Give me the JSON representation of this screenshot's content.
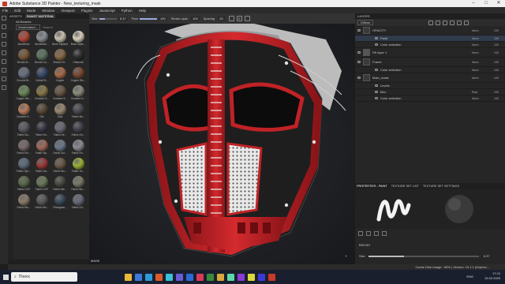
{
  "window": {
    "title": "Adobe Substance 3D Painter - New_texturing_mask",
    "controls": [
      "–",
      "□",
      "✕"
    ]
  },
  "menu": [
    "File",
    "Edit",
    "Mode",
    "Window",
    "Viewport",
    "Plugins",
    "Javascript",
    "Python",
    "Help"
  ],
  "toolbar": {
    "size_label": "Size",
    "size_value": "6.37",
    "size_fraction": 0.32,
    "flow_label": "Flow",
    "flow_value": "100",
    "flow_fraction": 1.0,
    "stroke_opacity_label": "Stroke opac",
    "stroke_opacity_value": "100",
    "spacing_label": "Spacing",
    "spacing_value": "20",
    "symmetry_label": "X"
  },
  "assets": {
    "tabs": [
      "ASSETS",
      "SMART MATERIAL"
    ],
    "library_label": "All libraries",
    "filter_chip": "Smartmateri...",
    "search_placeholder": "Search",
    "materials": [
      {
        "name": "Aluminium",
        "color": "#b34a3c"
      },
      {
        "name": "Aluminium...",
        "color": "#8a8f95"
      },
      {
        "name": "Bone Stylized",
        "color": "#c9c1b0"
      },
      {
        "name": "Bone Styliz...",
        "color": "#d8cfba"
      },
      {
        "name": "Bronze Ar...",
        "color": "#7a5a3a"
      },
      {
        "name": "Bronze Co...",
        "color": "#5e7560"
      },
      {
        "name": "Bronze St...",
        "color": "#8a6a48"
      },
      {
        "name": "Charcoal",
        "color": "#2f2f2f"
      },
      {
        "name": "Chrome Bl...",
        "color": "#6a7080"
      },
      {
        "name": "Cobalt St...",
        "color": "#3c4a6a"
      },
      {
        "name": "Copper",
        "color": "#a86a4a"
      },
      {
        "name": "Copper Wo...",
        "color": "#7a4a32"
      },
      {
        "name": "Copper We...",
        "color": "#6e8a5a"
      },
      {
        "name": "Creature S...",
        "color": "#8a7a4a"
      },
      {
        "name": "Creature S...",
        "color": "#6a5a48"
      },
      {
        "name": "Creature S...",
        "color": "#8c8c7c"
      },
      {
        "name": "Creature S...",
        "color": "#b87a5a"
      },
      {
        "name": "Dirt",
        "color": "#5a4a38"
      },
      {
        "name": "Dust",
        "color": "#9a8a72"
      },
      {
        "name": "Fabric Ba...",
        "color": "#4a4a52"
      },
      {
        "name": "Fabric Bu...",
        "color": "#5a5a62"
      },
      {
        "name": "Fabric De...",
        "color": "#3a3a48"
      },
      {
        "name": "Fabric De...",
        "color": "#6a6a78"
      },
      {
        "name": "Fabric Ge...",
        "color": "#42424e"
      },
      {
        "name": "Fabric Kni...",
        "color": "#7a6a6a"
      },
      {
        "name": "Fabric Ny...",
        "color": "#a06a5a"
      },
      {
        "name": "Fabric Sof...",
        "color": "#6a7a8a"
      },
      {
        "name": "Fabric Ro...",
        "color": "#8a8a92"
      },
      {
        "name": "Fabric Syn...",
        "color": "#5a6a7a"
      },
      {
        "name": "Fabric Sa...",
        "color": "#9a3a3a"
      },
      {
        "name": "Fabric Wo...",
        "color": "#6a5a48"
      },
      {
        "name": "Fabric Ya...",
        "color": "#9ab03a"
      },
      {
        "name": "Fabric UCP",
        "color": "#5a6a4a"
      },
      {
        "name": "Fabric UCP",
        "color": "#6a7a5a"
      },
      {
        "name": "Fabric We...",
        "color": "#4a4a42"
      },
      {
        "name": "Fabric Wo...",
        "color": "#7a7a6a"
      },
      {
        "name": "Fabric Wo...",
        "color": "#8a7a6a"
      },
      {
        "name": "Fabric Wo...",
        "color": "#5a5a5a"
      },
      {
        "name": "Fiberglass...",
        "color": "#3a4a5a"
      },
      {
        "name": "Fabric Dri...",
        "color": "#6a6a7a"
      }
    ]
  },
  "viewport": {
    "label": "MASK",
    "axis": "Y"
  },
  "layers": {
    "header": "LAYERS",
    "blend_mode": "Diffuse",
    "rows": [
      {
        "name": "OPACITY",
        "blend": "Norm",
        "opacity": "100",
        "kind": "folder",
        "thumb": "#3a3a3a"
      },
      {
        "name": "Paint",
        "blend": "Norm",
        "opacity": "100",
        "kind": "sub",
        "selected": true,
        "thumb": "#2a2a2a"
      },
      {
        "name": "Color selection",
        "blend": "Norm",
        "opacity": "100",
        "kind": "sub",
        "thumb": "#2a2a2a"
      },
      {
        "name": "Fill layer 1",
        "blend": "Norm",
        "opacity": "100",
        "kind": "layer",
        "thumb": "#555"
      },
      {
        "name": "Frame",
        "blend": "Norm",
        "opacity": "100",
        "kind": "folder",
        "thumb": "#3a3a3a"
      },
      {
        "name": "Color selection",
        "blend": "Norm",
        "opacity": "100",
        "kind": "sub",
        "thumb": "#2a2a2a"
      },
      {
        "name": "Main_mask",
        "blend": "Norm",
        "opacity": "100",
        "kind": "folder",
        "thumb": "#3a3a3a"
      },
      {
        "name": "Levels",
        "blend": "",
        "opacity": "",
        "kind": "sub",
        "thumb": "#2a2a2a"
      },
      {
        "name": "Blur",
        "blend": "Repl",
        "opacity": "100",
        "kind": "sub",
        "thumb": "#2a2a2a"
      },
      {
        "name": "Color selection",
        "blend": "Norm",
        "opacity": "100",
        "kind": "sub",
        "thumb": "#2a2a2a"
      }
    ]
  },
  "properties": {
    "tabs": [
      "PROPERTIES - PAINT",
      "TEXTURE SET LIST",
      "TEXTURE SET SETTINGS"
    ],
    "section": "BRUSH",
    "size_label": "Size",
    "size_value": "6.37",
    "size_fraction": 0.32
  },
  "status": {
    "text": "Cache Disk Usage : 83% | Version: 10.1.1 (Expires..."
  },
  "taskbar": {
    "search_placeholder": "Поиск",
    "language": "ENG",
    "time": "17:24",
    "date": "15.02.2025",
    "apps": [
      "#e8b83a",
      "#3a7ad8",
      "#2a9ad8",
      "#d85a2a",
      "#3ac0d8",
      "#6a5ad8",
      "#2a6ad8",
      "#d83a5a",
      "#3a8a3a",
      "#d8a83a",
      "#5ad8a8",
      "#8a3ad8",
      "#d8d83a",
      "#3a3ad8",
      "#c83a2a"
    ]
  }
}
